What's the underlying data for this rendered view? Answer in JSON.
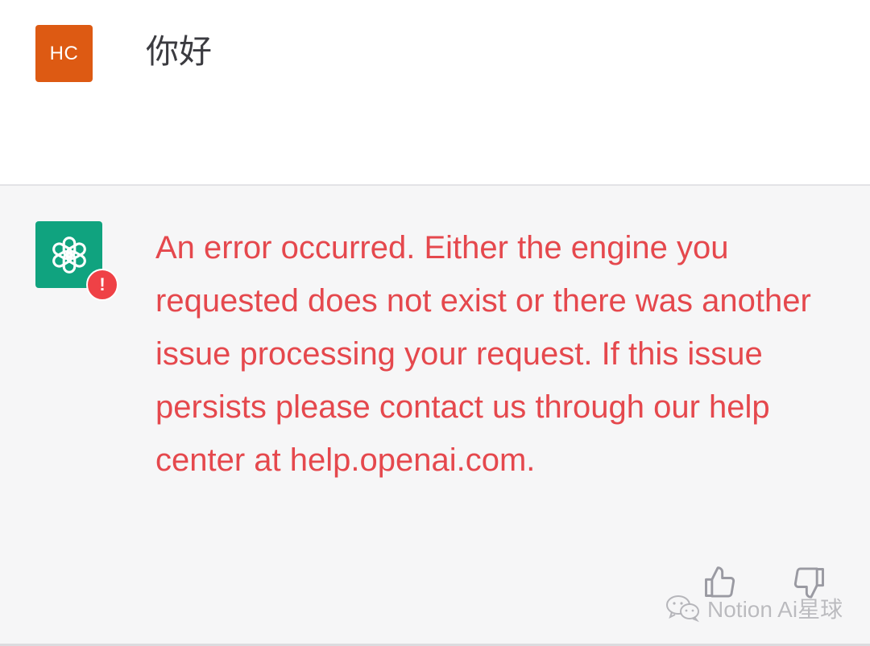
{
  "conversation": {
    "user": {
      "avatar_initials": "HC",
      "avatar_color": "#dd5a13",
      "message": "你好"
    },
    "assistant": {
      "avatar_icon": "openai-logo-icon",
      "avatar_color": "#10a37f",
      "error_badge": "!",
      "error_badge_color": "#ef4146",
      "error_color": "#e5484d",
      "error_message": "An error occurred. Either the engine you requested does not exist or there was another issue processing your request. If this issue persists please contact us through our help center at help.openai.com."
    }
  },
  "feedback": {
    "thumbs_up_icon": "thumbs-up-icon",
    "thumbs_down_icon": "thumbs-down-icon"
  },
  "watermark": {
    "icon": "wechat-icon",
    "text": "Notion Ai星球"
  }
}
